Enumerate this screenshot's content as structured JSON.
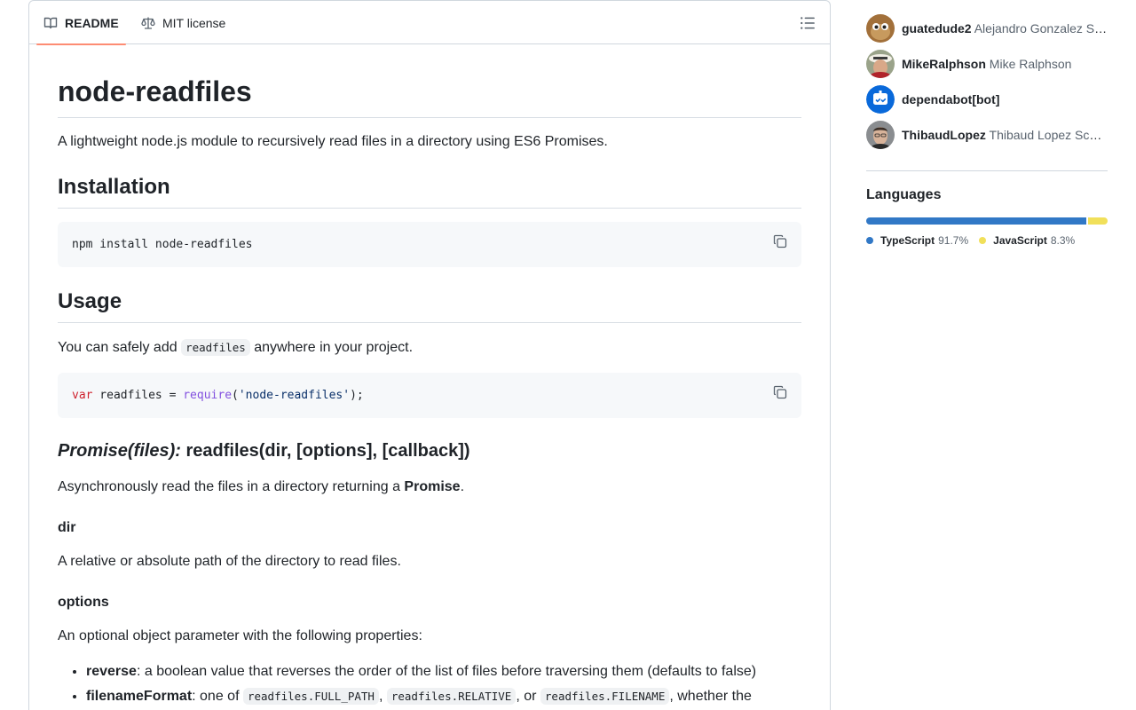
{
  "tabs": {
    "readme": "README",
    "license": "MIT license"
  },
  "readme": {
    "title": "node-readfiles",
    "description": "A lightweight node.js module to recursively read files in a directory using ES6 Promises.",
    "installation_heading": "Installation",
    "install_code": "npm install node-readfiles",
    "usage_heading": "Usage",
    "usage_text_before": "You can safely add ",
    "usage_code_inline": "readfiles",
    "usage_text_after": " anywhere in your project.",
    "require_code": {
      "kw": "var",
      "mid": " readfiles = ",
      "fn": "require",
      "open": "(",
      "str": "'node-readfiles'",
      "close": ");"
    },
    "api_heading_em": "Promise(files):",
    "api_heading_rest": " readfiles(dir, [options], [callback])",
    "api_desc_before": "Asynchronously read the files in a directory returning a ",
    "api_desc_strong": "Promise",
    "api_desc_after": ".",
    "dir_heading": "dir",
    "dir_desc": "A relative or absolute path of the directory to read files.",
    "options_heading": "options",
    "options_desc": "An optional object parameter with the following properties:",
    "props": [
      {
        "name": "reverse",
        "text": ": a boolean value that reverses the order of the list of files before traversing them (defaults to false)"
      },
      {
        "name": "filenameFormat",
        "text1": ": one of ",
        "code1": "readfiles.FULL_PATH",
        "sep1": ", ",
        "code2": "readfiles.RELATIVE",
        "sep2": ", or ",
        "code3": "readfiles.FILENAME",
        "text2": ", whether the"
      }
    ]
  },
  "contributors": [
    {
      "login": "guatedude2",
      "name": "Alejandro Gonzalez Sole"
    },
    {
      "login": "MikeRalphson",
      "name": "Mike Ralphson"
    },
    {
      "login": "dependabot[bot]",
      "name": ""
    },
    {
      "login": "ThibaudLopez",
      "name": "Thibaud Lopez Schneider"
    }
  ],
  "languages": {
    "title": "Languages",
    "items": [
      {
        "name": "TypeScript",
        "percent": "91.7%",
        "value": 91.7,
        "color": "#3178c6"
      },
      {
        "name": "JavaScript",
        "percent": "8.3%",
        "value": 8.3,
        "color": "#f1e05a"
      }
    ]
  },
  "colors": {
    "accent_tab": "#fd8c73",
    "border": "#d0d7de",
    "code_bg": "#f6f8fa"
  }
}
